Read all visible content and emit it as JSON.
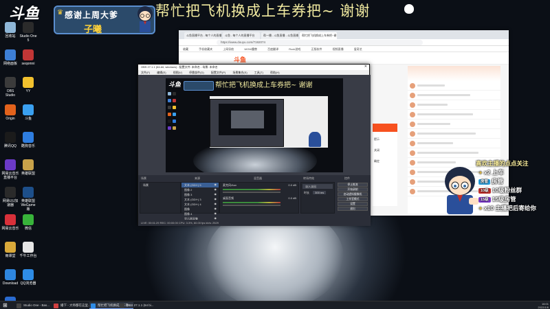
{
  "overlay": {
    "logo": "斗鱼",
    "thanks_title": "感谢上周大爹",
    "thanks_name": "子曦",
    "banner": "帮忙把飞机换成上车券把~ 谢谢"
  },
  "desktop_icons": [
    {
      "label": "回收站",
      "color": "#8fb7d8"
    },
    {
      "label": "Studio One 5",
      "color": "#2b2b2b"
    },
    {
      "label": "网络面板",
      "color": "#3d7fd6"
    },
    {
      "label": "seqomni",
      "color": "#c23636"
    },
    {
      "label": "OBS Studio",
      "color": "#3b3b3b"
    },
    {
      "label": "YY",
      "color": "#f2c12e"
    },
    {
      "label": "Origin",
      "color": "#e2621c"
    },
    {
      "label": "斗鱼",
      "color": "#3aa0f0"
    },
    {
      "label": "腾讯QQ",
      "color": "#1b1b1b"
    },
    {
      "label": "酷狗音乐",
      "color": "#2e7de0"
    },
    {
      "label": "网易云音乐直播平台",
      "color": "#6b3ac7"
    },
    {
      "label": "英雄联盟",
      "color": "#c8a24a"
    },
    {
      "label": "网易UU加速器",
      "color": "#2a2a2a"
    },
    {
      "label": "英雄联盟WeGame版",
      "color": "#1d4f8a"
    },
    {
      "label": "网易云音乐",
      "color": "#d8303a"
    },
    {
      "label": "微信",
      "color": "#38b33a"
    },
    {
      "label": "雨课堂",
      "color": "#d9a93a"
    },
    {
      "label": "千牛工作台",
      "color": "#e6e6e6"
    },
    {
      "label": "Download",
      "color": "#2e86de"
    },
    {
      "label": "QQ浏览器",
      "color": "#2e8ce6"
    },
    {
      "label": "QQ游戏",
      "color": "#2a6bd0"
    }
  ],
  "browser": {
    "tabs": [
      "斗鱼直播平台 - 每个人的直播平台",
      "斗鱼 - 每个人的直播平台",
      "帮一播 - 斗鱼直播 - 斗鱼直播...",
      "帮忙把飞机换成上车券把~谢谢..."
    ],
    "active_tab": 3,
    "url": "https://www.douyu.com/7192074",
    "bookmarks": [
      "收藏",
      "手机收藏夹",
      "上网导航",
      "WOW魔兽",
      "百度翻译",
      "Rock游戏",
      "正版软件",
      "视频直播",
      "爱奇艺"
    ],
    "site_logo": "斗鱼",
    "dialog_items": [
      "提示",
      "关闭",
      "确定"
    ]
  },
  "obs": {
    "window_title": "OBS 27.1.1 (64-bit, windows) - 配置文件: 未命名 - 场景: 未命名",
    "menu": [
      "文件(F)",
      "编辑(E)",
      "视图(V)",
      "停靠部件(D)",
      "配置文件(P)",
      "场景集合(S)",
      "工具(T)",
      "帮助(H)"
    ],
    "dock_headers": [
      "来源",
      "场景",
      "混音器",
      "转场特效",
      "控件"
    ],
    "scenes": [
      "场景"
    ],
    "sources": [
      "文本 (GDI+) 5",
      "图像 2",
      "图像 3",
      "文本 (GDI+) 3",
      "文本 (GDI+) 4",
      "图像",
      "图像 4",
      "显示器采集"
    ],
    "mixer": [
      {
        "name": "麦克风/Aux",
        "level": "0.0 dB"
      },
      {
        "name": "桌面音频",
        "level": "0.0 dB"
      }
    ],
    "transition": {
      "type": "淡入淡出",
      "duration_label": "时长",
      "duration": "300 ms"
    },
    "controls": [
      "停止推流",
      "开始录制",
      "启动虚拟摄像机",
      "工作室模式",
      "设置",
      "退出"
    ],
    "status": "LIVE: 00:01:29   REC: 00:00:00   CPU: 3.3%, 60.00 fps   kb/s: 2529"
  },
  "gift_feed": [
    {
      "badge": "",
      "text": "喜欢主播的点点关注",
      "color": "#fff3a0"
    },
    {
      "badge": "",
      "text": "x2 上车",
      "color": "#ffffff"
    },
    {
      "badge": "房管",
      "text": "房管",
      "color": "#ffffff"
    },
    {
      "badge": "10级",
      "text": "10级粉丝群",
      "color": "#ffffff"
    },
    {
      "badge": "15级",
      "text": "15级房管",
      "color": "#ffffff"
    },
    {
      "badge": "",
      "text": "x10 主播把后寄给你",
      "color": "#ffffff"
    }
  ],
  "taskbar": {
    "items": [
      {
        "label": "Studio One - Bas...",
        "color": "#444"
      },
      {
        "label": "播下 - 大师都在这里...",
        "color": "#d04040"
      },
      {
        "label": "帮忙把飞机换成上车券...",
        "color": "#2e8ce6"
      },
      {
        "label": "OBS 27.1.1 (64 bi...",
        "color": "#3b3b3b"
      }
    ],
    "active_item": 2,
    "time": "16:01",
    "date": "2022/1/6"
  },
  "colors": {
    "douyu_orange": "#f7511f",
    "banner_text": "#f1eaa0",
    "obs_bg": "#2b2e38"
  }
}
